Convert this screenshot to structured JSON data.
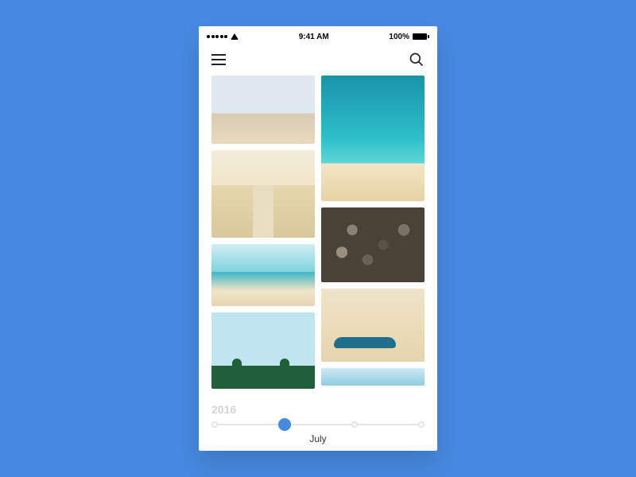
{
  "status": {
    "time": "9:41 AM",
    "battery": "100%"
  },
  "timeline": {
    "year": "2016",
    "month": "July"
  },
  "icons": {
    "menu": "menu-icon",
    "search": "search-icon"
  }
}
